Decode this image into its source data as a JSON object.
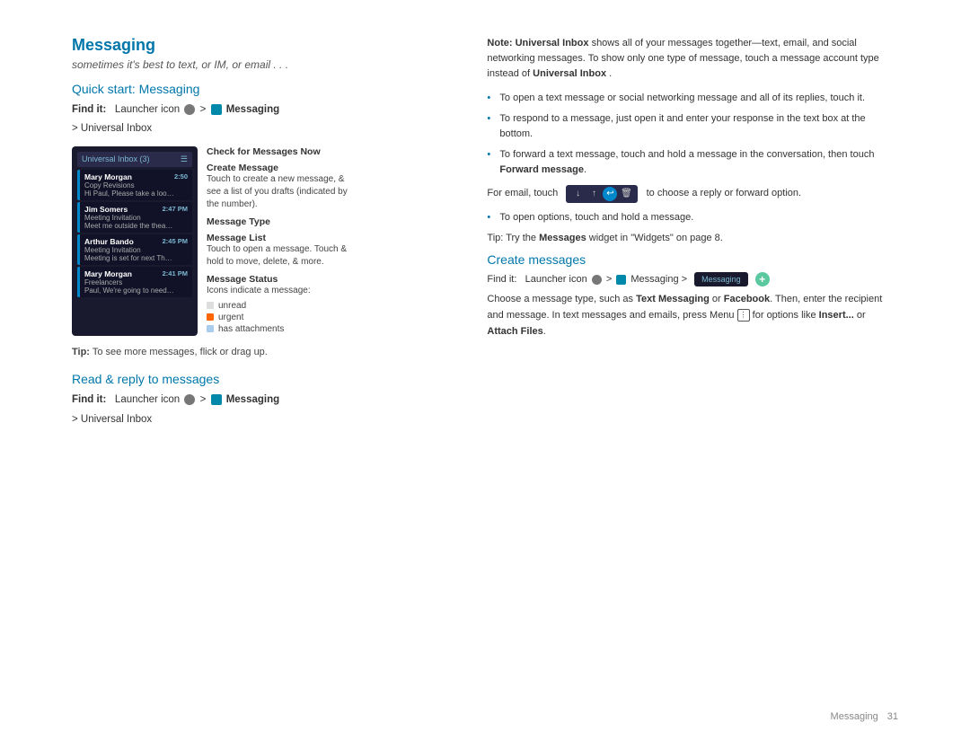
{
  "page": {
    "background": "#ffffff"
  },
  "header": {
    "title": "Messaging",
    "subtitle": "sometimes it's best to text, or IM, or email . . ."
  },
  "left": {
    "quick_start": {
      "title": "Quick start: Messaging",
      "find_it_label": "Find it:",
      "find_it_text": "Launcher icon",
      "find_it_separator": ">",
      "find_it_app": "Messaging",
      "find_it_second": "> Universal Inbox"
    },
    "screenshot": {
      "inbox_header": "Universal Inbox (3)",
      "messages": [
        {
          "sender": "Mary Morgan",
          "time": "2:50",
          "preview": "Copy Revisions",
          "preview2": "Hi Paul, Please take a look..."
        },
        {
          "sender": "Jim Somers",
          "time": "2:47 PM",
          "preview": "Meeting Invitation",
          "preview2": "Meet me outside the theater &..."
        },
        {
          "sender": "Arthur Bando",
          "time": "2:45 PM",
          "preview": "Meeting Invitation",
          "preview2": "Meeting is set for next Thu ay at..."
        },
        {
          "sender": "Mary Morgan",
          "time": "2:41 PM",
          "preview": "Freelancers",
          "preview2": "Paul, We're going to need to..."
        }
      ]
    },
    "labels": {
      "check": {
        "title": "Check for Messages Now",
        "desc": ""
      },
      "create": {
        "title": "Create Message",
        "desc": "Touch to create a new message, & see a list of you drafts (indicated by the number)."
      },
      "type": {
        "title": "Message Type",
        "desc": ""
      },
      "list": {
        "title": "Message List",
        "desc": "Touch to open a message. Touch & hold to move, delete, & more."
      },
      "status": {
        "title": "Message Status",
        "desc": "Icons indicate a message:",
        "items": [
          "unread",
          "urgent",
          "has attachments"
        ]
      }
    },
    "tip": {
      "label": "Tip:",
      "text": "To see more messages, flick or drag up."
    },
    "read_reply": {
      "title": "Read & reply to messages",
      "find_it_label": "Find it:",
      "find_it_text": "Launcher icon",
      "find_it_separator": ">",
      "find_it_app": "Messaging",
      "find_it_second": "> Universal Inbox"
    }
  },
  "right": {
    "note": {
      "label": "Note:",
      "bold_text": "Universal Inbox",
      "text1": " shows all of your messages together—text, email, and social networking messages. To show only one type of message, touch a message account type instead of ",
      "bold_text2": "Universal Inbox",
      "text2": "."
    },
    "bullets": [
      "To open a text message or social networking message and all of its replies, touch it.",
      "To respond to a message, just open it and enter your response in the text box at the bottom.",
      "To forward a text message, touch and hold a message in the conversation, then touch Forward message."
    ],
    "email_touch": {
      "prefix": "For email, touch",
      "icon_label": "icon",
      "suffix": " to choose a reply or forward option.",
      "bullet": "To open options, touch and hold a message."
    },
    "tip": {
      "label": "Tip:",
      "text": "Try the",
      "bold": "Messages",
      "text2": "widget in \"Widgets\" on page 8."
    },
    "create_messages": {
      "title": "Create messages",
      "find_it_label": "Find it:",
      "find_it_text": "Launcher icon",
      "find_it_separator": ">",
      "find_it_app": "Messaging",
      "find_it_arrow": ">",
      "bar_label": "Messaging",
      "desc_part1": "Choose a message type, such as ",
      "bold1": "Text Messaging",
      "desc_part2": " or ",
      "bold2": "Facebook",
      "desc_part3": ". Then, enter the recipient and message. In text messages and emails, press Menu",
      "desc_part4": " for options like ",
      "bold3": "Insert...",
      "desc_part5": " or ",
      "bold4": "Attach Files",
      "desc_part6": "."
    }
  },
  "footer": {
    "section": "Messaging",
    "page_number": "31"
  }
}
